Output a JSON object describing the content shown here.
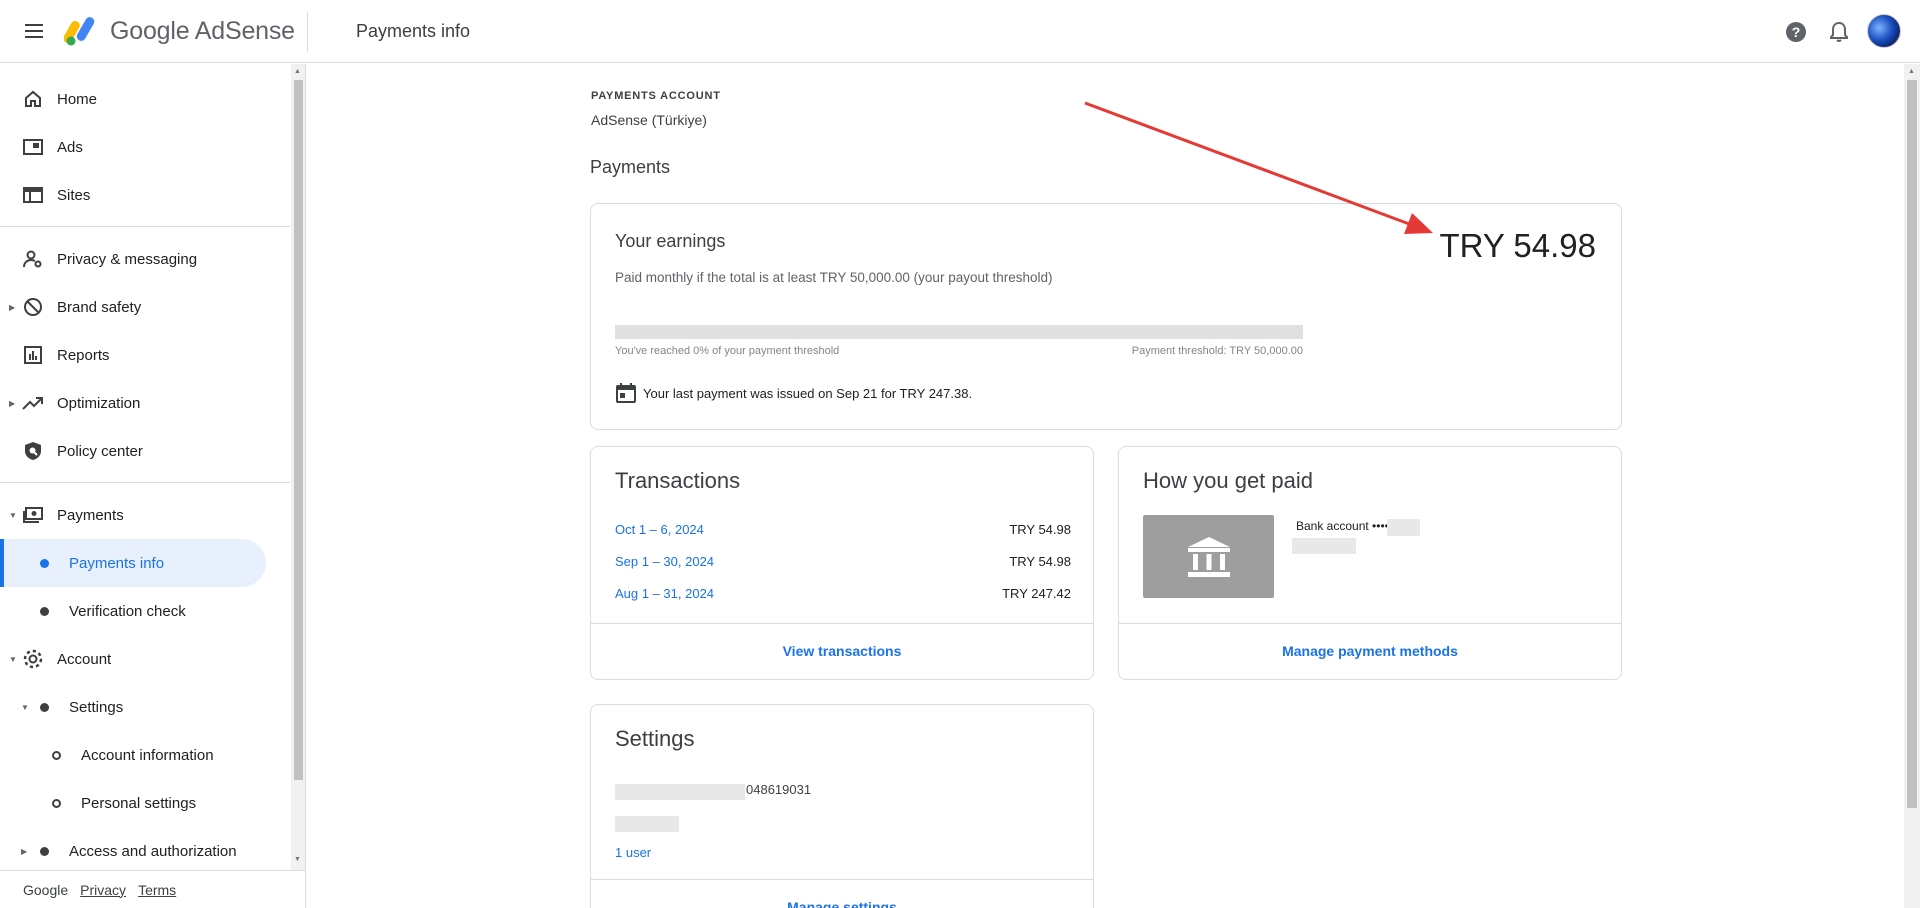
{
  "topbar": {
    "brand_google": "Google",
    "brand_product": "AdSense",
    "page_title": "Payments info"
  },
  "sidebar": {
    "items": [
      {
        "label": "Home",
        "icon": "home-icon"
      },
      {
        "label": "Ads",
        "icon": "ads-icon"
      },
      {
        "label": "Sites",
        "icon": "sites-icon"
      },
      {
        "label": "Privacy & messaging",
        "icon": "privacy-icon"
      },
      {
        "label": "Brand safety",
        "icon": "block-icon"
      },
      {
        "label": "Reports",
        "icon": "reports-icon"
      },
      {
        "label": "Optimization",
        "icon": "trending-up-icon"
      },
      {
        "label": "Policy center",
        "icon": "shield-search-icon"
      },
      {
        "label": "Payments",
        "icon": "payments-icon"
      },
      {
        "label": "Payments info"
      },
      {
        "label": "Verification check"
      },
      {
        "label": "Account",
        "icon": "gear-icon"
      },
      {
        "label": "Settings"
      },
      {
        "label": "Account information"
      },
      {
        "label": "Personal settings"
      },
      {
        "label": "Access and authorization"
      }
    ],
    "footer": {
      "google": "Google",
      "privacy": "Privacy",
      "terms": "Terms"
    }
  },
  "main": {
    "account_eyebrow": "PAYMENTS ACCOUNT",
    "account_name": "AdSense (Türkiye)",
    "section_title": "Payments",
    "earnings": {
      "title": "Your earnings",
      "subtitle": "Paid monthly if the total is at least TRY 50,000.00 (your payout threshold)",
      "amount": "TRY 54.98",
      "progress_percent": 0,
      "progress_left": "You've reached 0% of your payment threshold",
      "progress_right": "Payment threshold: TRY 50,000.00",
      "last_payment": "Your last payment was issued on Sep 21 for TRY 247.38."
    },
    "transactions": {
      "title": "Transactions",
      "rows": [
        {
          "date": "Oct 1 – 6, 2024",
          "amount": "TRY 54.98"
        },
        {
          "date": "Sep 1 – 30, 2024",
          "amount": "TRY 54.98"
        },
        {
          "date": "Aug 1 – 31, 2024",
          "amount": "TRY 247.42"
        }
      ],
      "link": "View transactions"
    },
    "how_paid": {
      "title": "How you get paid",
      "bank_label": "Bank account ••••",
      "link": "Manage payment methods"
    },
    "settings": {
      "title": "Settings",
      "customer_id_suffix": "048619031",
      "users_link": "1 user",
      "link": "Manage settings"
    }
  },
  "colors": {
    "accent": "#1a73e8",
    "active_bg": "#e8f0fe",
    "annotation_arrow": "#e53935"
  }
}
